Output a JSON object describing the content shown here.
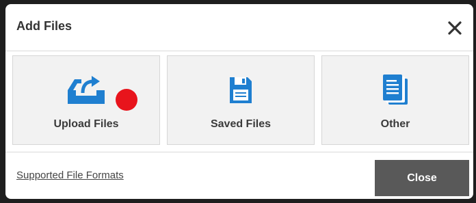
{
  "dialog": {
    "title": "Add Files",
    "close_icon": "close-icon"
  },
  "tiles": [
    {
      "label": "Upload Files",
      "icon": "upload-tray-icon"
    },
    {
      "label": "Saved Files",
      "icon": "floppy-disk-icon"
    },
    {
      "label": "Other",
      "icon": "documents-icon"
    }
  ],
  "footer": {
    "formats_link": "Supported File Formats",
    "close_button": "Close"
  },
  "colors": {
    "icon_blue": "#1f7fd0",
    "close_button_bg": "#595959",
    "tile_bg": "#f2f2f2",
    "marker_red": "#e8141c"
  }
}
